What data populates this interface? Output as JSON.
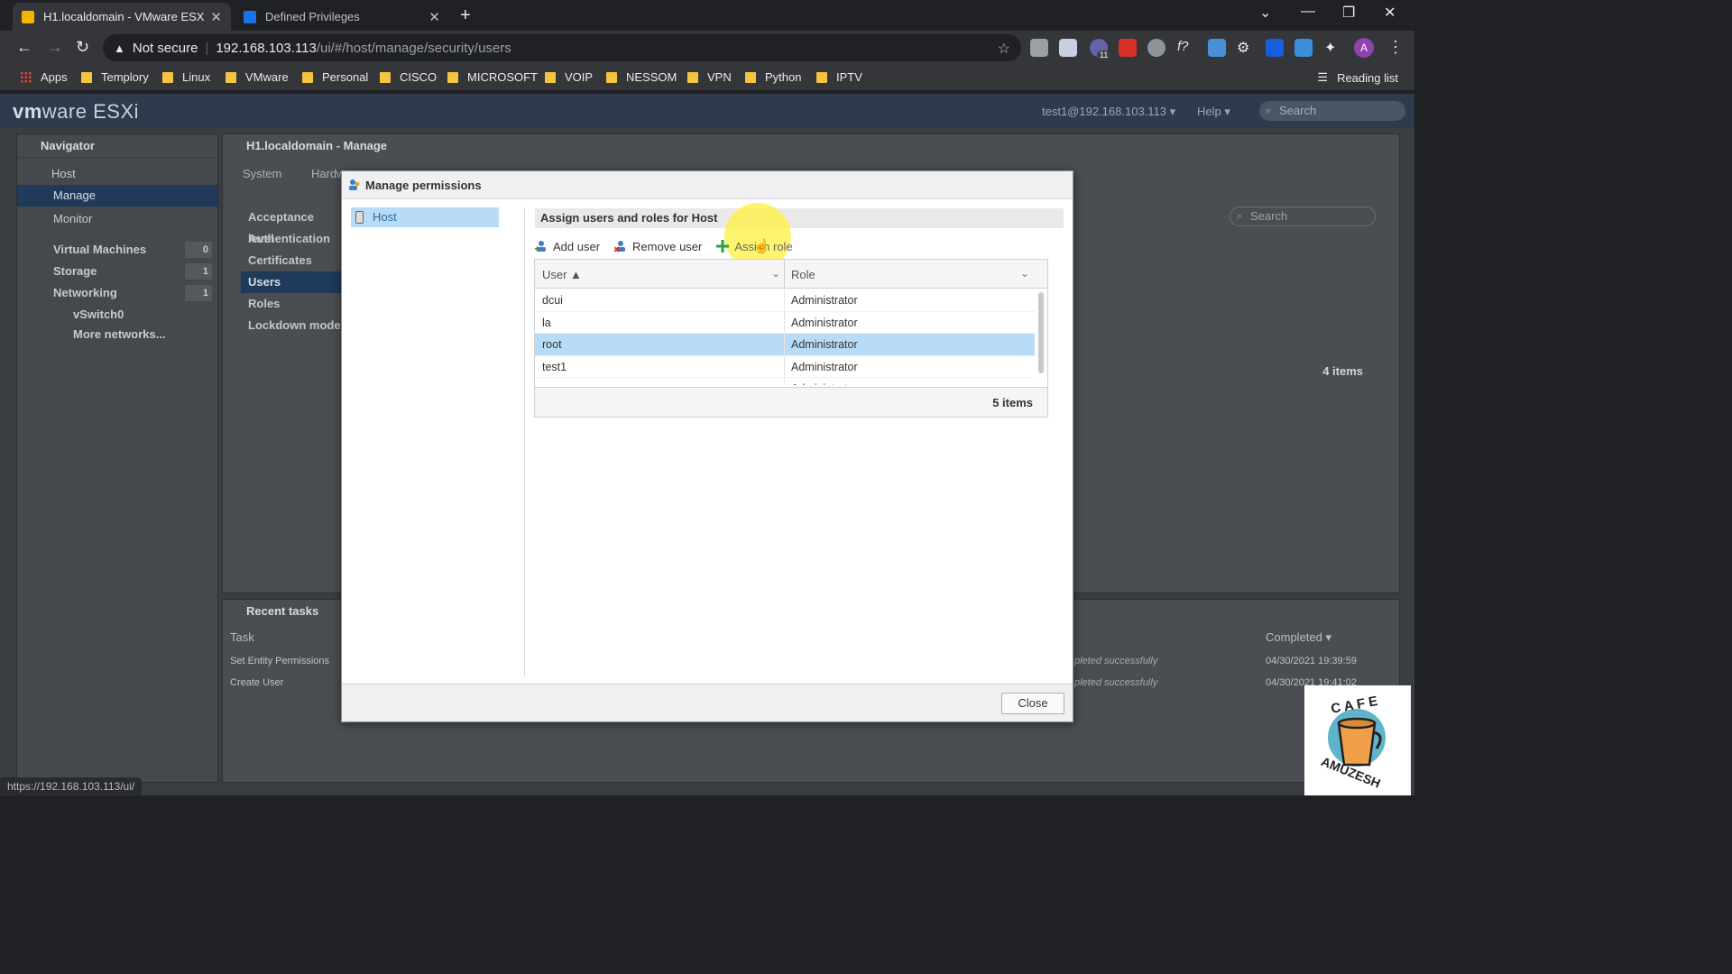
{
  "browser": {
    "tabs": [
      {
        "title": "H1.localdomain - VMware ESXi"
      },
      {
        "title": "Defined Privileges"
      }
    ],
    "address": {
      "security": "Not secure",
      "host": "192.168.103.113",
      "path": "/ui/#/host/manage/security/users"
    },
    "bookmarks": [
      "Apps",
      "Templory",
      "Linux",
      "VMware",
      "Personal",
      "CISCO",
      "MICROSOFT",
      "VOIP",
      "NESSOM",
      "VPN",
      "Python",
      "IPTV"
    ],
    "reading_list": "Reading list",
    "profile_initial": "A",
    "ext_badge": "11",
    "status_url": "https://192.168.103.113/ui/"
  },
  "esxi": {
    "brand_a": "vm",
    "brand_b": "ware",
    "brand_c": " ESXi",
    "user": "test1@192.168.103.113 ▾",
    "help": "Help ▾",
    "search_placeholder": "Search",
    "navigator": {
      "title": "Navigator",
      "host": "Host",
      "manage": "Manage",
      "monitor": "Monitor",
      "vms": "Virtual Machines",
      "vms_count": "0",
      "storage": "Storage",
      "storage_count": "1",
      "networking": "Networking",
      "networking_count": "1",
      "vswitch": "vSwitch0",
      "more": "More networks..."
    },
    "main": {
      "title": "H1.localdomain - Manage",
      "tab_system": "System",
      "tab_hardware": "Hardw",
      "security_nav": [
        "Acceptance level",
        "Authentication",
        "Certificates",
        "Users",
        "Roles",
        "Lockdown mode"
      ],
      "search": "Search",
      "count": "4 items"
    },
    "tasks": {
      "title": "Recent tasks",
      "col_task": "Task",
      "col_completed": "Completed ▾",
      "rows": [
        {
          "task": "Set Entity Permissions",
          "result": "pleted successfully",
          "completed": "04/30/2021 19:39:59"
        },
        {
          "task": "Create User",
          "result": "pleted successfully",
          "completed": "04/30/2021 19:41:02"
        }
      ]
    }
  },
  "modal": {
    "title": "Manage permissions",
    "tree_item": "Host",
    "section": "Assign users and roles for Host",
    "add_user": "Add user",
    "remove_user": "Remove user",
    "assign_role": "Assign role",
    "col_user": "User ▲",
    "col_role": "Role",
    "rows": [
      {
        "user": "dcui",
        "role": "Administrator"
      },
      {
        "user": "la",
        "role": "Administrator"
      },
      {
        "user": "root",
        "role": "Administrator"
      },
      {
        "user": "test1",
        "role": "Administrator"
      },
      {
        "user": "vpxuser",
        "role": "Administrator"
      }
    ],
    "count": "5 items",
    "close": "Close"
  },
  "watermark": {
    "text": "CAFE AMUZESH"
  }
}
